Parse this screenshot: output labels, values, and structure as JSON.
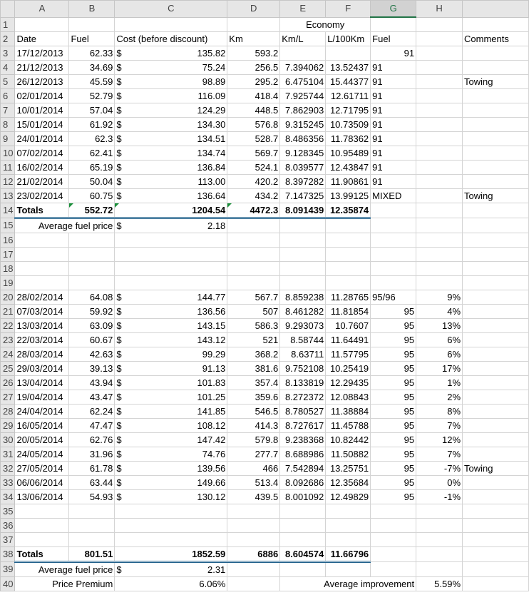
{
  "columns": [
    "A",
    "B",
    "C",
    "D",
    "E",
    "F",
    "G",
    "H"
  ],
  "selected_column": "G",
  "header": {
    "economy": "Economy",
    "date": "Date",
    "fuel": "Fuel",
    "cost": "Cost (before discount)",
    "km": "Km",
    "kml": "Km/L",
    "l100": "L/100Km",
    "fuel_type": "Fuel",
    "comments": "Comments"
  },
  "currency": "$",
  "rows_block1": [
    {
      "row": 3,
      "date": "17/12/2013",
      "fuel": "62.33",
      "cost": "135.82",
      "km": "593.2",
      "kml": "",
      "l100": "",
      "ftype": "91",
      "ftype_align": "r",
      "pct": "",
      "comment": ""
    },
    {
      "row": 4,
      "date": "21/12/2013",
      "fuel": "34.69",
      "cost": "75.24",
      "km": "256.5",
      "kml": "7.394062",
      "l100": "13.52437",
      "ftype": "91",
      "ftype_align": "l",
      "pct": "",
      "comment": ""
    },
    {
      "row": 5,
      "date": "26/12/2013",
      "fuel": "45.59",
      "cost": "98.89",
      "km": "295.2",
      "kml": "6.475104",
      "l100": "15.44377",
      "ftype": "91",
      "ftype_align": "l",
      "pct": "",
      "comment": "Towing"
    },
    {
      "row": 6,
      "date": "02/01/2014",
      "fuel": "52.79",
      "cost": "116.09",
      "km": "418.4",
      "kml": "7.925744",
      "l100": "12.61711",
      "ftype": "91",
      "ftype_align": "l",
      "pct": "",
      "comment": ""
    },
    {
      "row": 7,
      "date": "10/01/2014",
      "fuel": "57.04",
      "cost": "124.29",
      "km": "448.5",
      "kml": "7.862903",
      "l100": "12.71795",
      "ftype": "91",
      "ftype_align": "l",
      "pct": "",
      "comment": ""
    },
    {
      "row": 8,
      "date": "15/01/2014",
      "fuel": "61.92",
      "cost": "134.30",
      "km": "576.8",
      "kml": "9.315245",
      "l100": "10.73509",
      "ftype": "91",
      "ftype_align": "l",
      "pct": "",
      "comment": ""
    },
    {
      "row": 9,
      "date": "24/01/2014",
      "fuel": "62.3",
      "cost": "134.51",
      "km": "528.7",
      "kml": "8.486356",
      "l100": "11.78362",
      "ftype": "91",
      "ftype_align": "l",
      "pct": "",
      "comment": ""
    },
    {
      "row": 10,
      "date": "07/02/2014",
      "fuel": "62.41",
      "cost": "134.74",
      "km": "569.7",
      "kml": "9.128345",
      "l100": "10.95489",
      "ftype": "91",
      "ftype_align": "l",
      "pct": "",
      "comment": ""
    },
    {
      "row": 11,
      "date": "16/02/2014",
      "fuel": "65.19",
      "cost": "136.84",
      "km": "524.1",
      "kml": "8.039577",
      "l100": "12.43847",
      "ftype": "91",
      "ftype_align": "l",
      "pct": "",
      "comment": ""
    },
    {
      "row": 12,
      "date": "21/02/2014",
      "fuel": "50.04",
      "cost": "113.00",
      "km": "420.2",
      "kml": "8.397282",
      "l100": "11.90861",
      "ftype": "91",
      "ftype_align": "l",
      "pct": "",
      "comment": ""
    },
    {
      "row": 13,
      "date": "23/02/2014",
      "fuel": "60.75",
      "cost": "136.64",
      "km": "434.2",
      "kml": "7.147325",
      "l100": "13.99125",
      "ftype": "MIXED",
      "ftype_align": "l",
      "pct": "",
      "comment": "Towing"
    }
  ],
  "totals1": {
    "label": "Totals",
    "fuel": "552.72",
    "cost": "1204.54",
    "km": "4472.3",
    "kml": "8.091439",
    "l100": "12.35874"
  },
  "avg1": {
    "label": "Average fuel price",
    "value": "2.18"
  },
  "rows_block2": [
    {
      "row": 20,
      "date": "28/02/2014",
      "fuel": "64.08",
      "cost": "144.77",
      "km": "567.7",
      "kml": "8.859238",
      "l100": "11.28765",
      "ftype": "95/96",
      "ftype_align": "l",
      "pct": "9%",
      "comment": ""
    },
    {
      "row": 21,
      "date": "07/03/2014",
      "fuel": "59.92",
      "cost": "136.56",
      "km": "507",
      "kml": "8.461282",
      "l100": "11.81854",
      "ftype": "95",
      "ftype_align": "r",
      "pct": "4%",
      "comment": ""
    },
    {
      "row": 22,
      "date": "13/03/2014",
      "fuel": "63.09",
      "cost": "143.15",
      "km": "586.3",
      "kml": "9.293073",
      "l100": "10.7607",
      "ftype": "95",
      "ftype_align": "r",
      "pct": "13%",
      "comment": ""
    },
    {
      "row": 23,
      "date": "22/03/2014",
      "fuel": "60.67",
      "cost": "143.12",
      "km": "521",
      "kml": "8.58744",
      "l100": "11.64491",
      "ftype": "95",
      "ftype_align": "r",
      "pct": "6%",
      "comment": ""
    },
    {
      "row": 24,
      "date": "28/03/2014",
      "fuel": "42.63",
      "cost": "99.29",
      "km": "368.2",
      "kml": "8.63711",
      "l100": "11.57795",
      "ftype": "95",
      "ftype_align": "r",
      "pct": "6%",
      "comment": ""
    },
    {
      "row": 25,
      "date": "29/03/2014",
      "fuel": "39.13",
      "cost": "91.13",
      "km": "381.6",
      "kml": "9.752108",
      "l100": "10.25419",
      "ftype": "95",
      "ftype_align": "r",
      "pct": "17%",
      "comment": ""
    },
    {
      "row": 26,
      "date": "13/04/2014",
      "fuel": "43.94",
      "cost": "101.83",
      "km": "357.4",
      "kml": "8.133819",
      "l100": "12.29435",
      "ftype": "95",
      "ftype_align": "r",
      "pct": "1%",
      "comment": ""
    },
    {
      "row": 27,
      "date": "19/04/2014",
      "fuel": "43.47",
      "cost": "101.25",
      "km": "359.6",
      "kml": "8.272372",
      "l100": "12.08843",
      "ftype": "95",
      "ftype_align": "r",
      "pct": "2%",
      "comment": ""
    },
    {
      "row": 28,
      "date": "24/04/2014",
      "fuel": "62.24",
      "cost": "141.85",
      "km": "546.5",
      "kml": "8.780527",
      "l100": "11.38884",
      "ftype": "95",
      "ftype_align": "r",
      "pct": "8%",
      "comment": ""
    },
    {
      "row": 29,
      "date": "16/05/2014",
      "fuel": "47.47",
      "cost": "108.12",
      "km": "414.3",
      "kml": "8.727617",
      "l100": "11.45788",
      "ftype": "95",
      "ftype_align": "r",
      "pct": "7%",
      "comment": ""
    },
    {
      "row": 30,
      "date": "20/05/2014",
      "fuel": "62.76",
      "cost": "147.42",
      "km": "579.8",
      "kml": "9.238368",
      "l100": "10.82442",
      "ftype": "95",
      "ftype_align": "r",
      "pct": "12%",
      "comment": ""
    },
    {
      "row": 31,
      "date": "24/05/2014",
      "fuel": "31.96",
      "cost": "74.76",
      "km": "277.7",
      "kml": "8.688986",
      "l100": "11.50882",
      "ftype": "95",
      "ftype_align": "r",
      "pct": "7%",
      "comment": ""
    },
    {
      "row": 32,
      "date": "27/05/2014",
      "fuel": "61.78",
      "cost": "139.56",
      "km": "466",
      "kml": "7.542894",
      "l100": "13.25751",
      "ftype": "95",
      "ftype_align": "r",
      "pct": "-7%",
      "comment": "Towing"
    },
    {
      "row": 33,
      "date": "06/06/2014",
      "fuel": "63.44",
      "cost": "149.66",
      "km": "513.4",
      "kml": "8.092686",
      "l100": "12.35684",
      "ftype": "95",
      "ftype_align": "r",
      "pct": "0%",
      "comment": ""
    },
    {
      "row": 34,
      "date": "13/06/2014",
      "fuel": "54.93",
      "cost": "130.12",
      "km": "439.5",
      "kml": "8.001092",
      "l100": "12.49829",
      "ftype": "95",
      "ftype_align": "r",
      "pct": "-1%",
      "comment": ""
    }
  ],
  "totals2": {
    "label": "Totals",
    "fuel": "801.51",
    "cost": "1852.59",
    "km": "6886",
    "kml": "8.604574",
    "l100": "11.66796"
  },
  "avg2": {
    "label": "Average fuel price",
    "value": "2.31"
  },
  "premium": {
    "label": "Price Premium",
    "value": "6.06%"
  },
  "improvement": {
    "label": "Average improvement",
    "value": "5.59%"
  }
}
